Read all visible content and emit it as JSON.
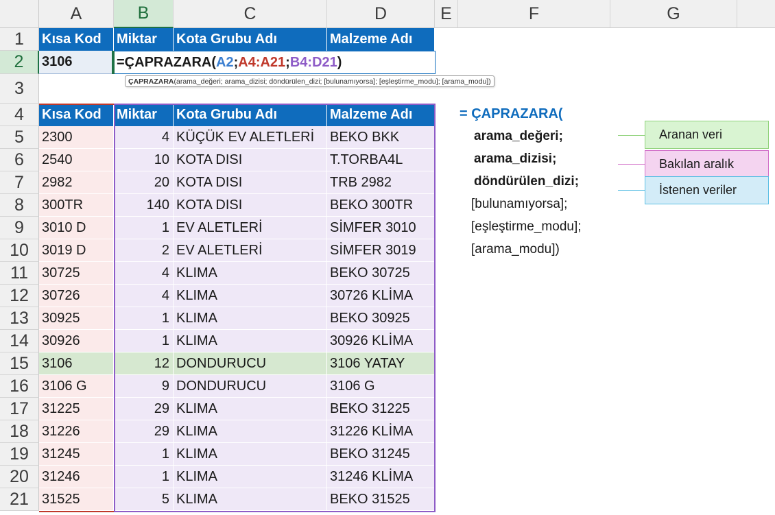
{
  "columns": [
    "A",
    "B",
    "C",
    "D",
    "E",
    "F",
    "G"
  ],
  "rows": [
    "1",
    "2",
    "3",
    "4",
    "5",
    "6",
    "7",
    "8",
    "9",
    "10",
    "11",
    "12",
    "13",
    "14",
    "15",
    "16",
    "17",
    "18",
    "19",
    "20",
    "21"
  ],
  "row1_headers": [
    "Kısa Kod",
    "Miktar",
    "Kota Grubu Adı",
    "Malzeme Adı"
  ],
  "row2": {
    "a2": "3106",
    "formula": {
      "prefix": "=ÇAPRAZARA(",
      "arg1": "A2",
      "sep1": ";",
      "arg2": "A4:A21",
      "sep2": ";",
      "arg3": "B4:D21",
      "suffix": ")"
    },
    "tooltip": {
      "name": "ÇAPRAZARA",
      "args": "(arama_değeri; arama_dizisi; döndürülen_dizi; [bulunamıyorsa]; [eşleştirme_modu]; [arama_modu])"
    }
  },
  "table_headers": [
    "Kısa Kod",
    "Miktar",
    "Kota Grubu Adı",
    "Malzeme Adı"
  ],
  "table_rows": [
    [
      "2300",
      "4",
      "KÜÇÜK EV ALETLERİ",
      "BEKO BKK"
    ],
    [
      "2540",
      "10",
      "KOTA DISI",
      "T.TORBA4L"
    ],
    [
      "2982",
      "20",
      "KOTA DISI",
      "TRB 2982"
    ],
    [
      "300TR",
      "140",
      "KOTA DISI",
      "BEKO 300TR"
    ],
    [
      "3010 D",
      "1",
      "EV ALETLERİ",
      "SİMFER 3010"
    ],
    [
      "3019 D",
      "2",
      "EV ALETLERİ",
      "SİMFER 3019"
    ],
    [
      "30725",
      "4",
      "KLIMA",
      "BEKO 30725"
    ],
    [
      "30726",
      "4",
      "KLIMA",
      "30726 KLİMA"
    ],
    [
      "30925",
      "1",
      "KLIMA",
      "BEKO 30925"
    ],
    [
      "30926",
      "1",
      "KLIMA",
      "30926 KLİMA"
    ],
    [
      "3106",
      "12",
      "DONDURUCU",
      "3106 YATAY"
    ],
    [
      "3106 G",
      "9",
      "DONDURUCU",
      "3106 G"
    ],
    [
      "31225",
      "29",
      "KLIMA",
      "BEKO 31225"
    ],
    [
      "31226",
      "29",
      "KLIMA",
      "31226 KLİMA"
    ],
    [
      "31245",
      "1",
      "KLIMA",
      "BEKO 31245"
    ],
    [
      "31246",
      "1",
      "KLIMA",
      "31246 KLİMA"
    ],
    [
      "31525",
      "5",
      "KLIMA",
      "BEKO 31525"
    ]
  ],
  "syntax": {
    "title": "= ÇAPRAZARA(",
    "lines": [
      "arama_değeri;",
      "arama_dizisi;",
      "döndürülen_dizi;",
      "[bulunamıyorsa];",
      "[eşleştirme_modu];",
      "[arama_modu])"
    ]
  },
  "legend": [
    "Aranan veri",
    "Bakılan aralık",
    "İstenen veriler"
  ],
  "colors": {
    "header_blue": "#0f6cbd",
    "arg1_blue": "#3b7fd0",
    "arg2_red": "#c0392b",
    "arg3_purple": "#8e5cc7",
    "col_a_fill": "#fbeaea",
    "col_bd_fill": "#efe8f7",
    "match_row_fill": "#d6e8d0",
    "legend_green": "#d9f4d2",
    "legend_pink": "#f4d4f0",
    "legend_blue": "#d3ecf8"
  }
}
